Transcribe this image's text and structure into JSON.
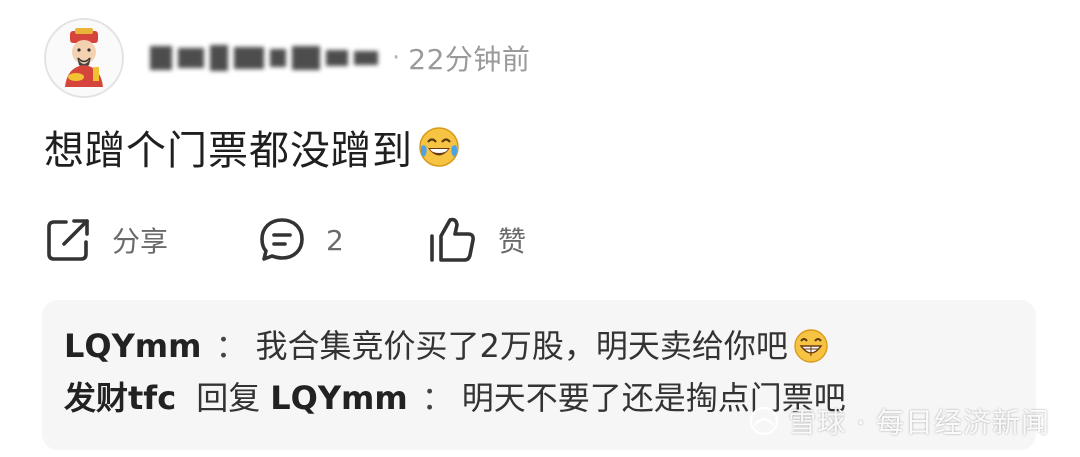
{
  "post": {
    "time_separator": "·",
    "time": "22分钟前",
    "text": "想蹭个门票都没蹭到"
  },
  "actions": {
    "share_label": "分享",
    "comment_count": "2",
    "like_label": "赞"
  },
  "replies": [
    {
      "author": "LQYmm",
      "colon": "：",
      "text": "我合集竞价买了2万股，明天卖给你吧"
    },
    {
      "author": "发财tfc",
      "reply_word": "回复",
      "target": "LQYmm",
      "colon": "：",
      "text": "明天不要了还是掏点门票吧"
    }
  ],
  "watermark": {
    "text": "雪球 · 每日经济新闻"
  }
}
